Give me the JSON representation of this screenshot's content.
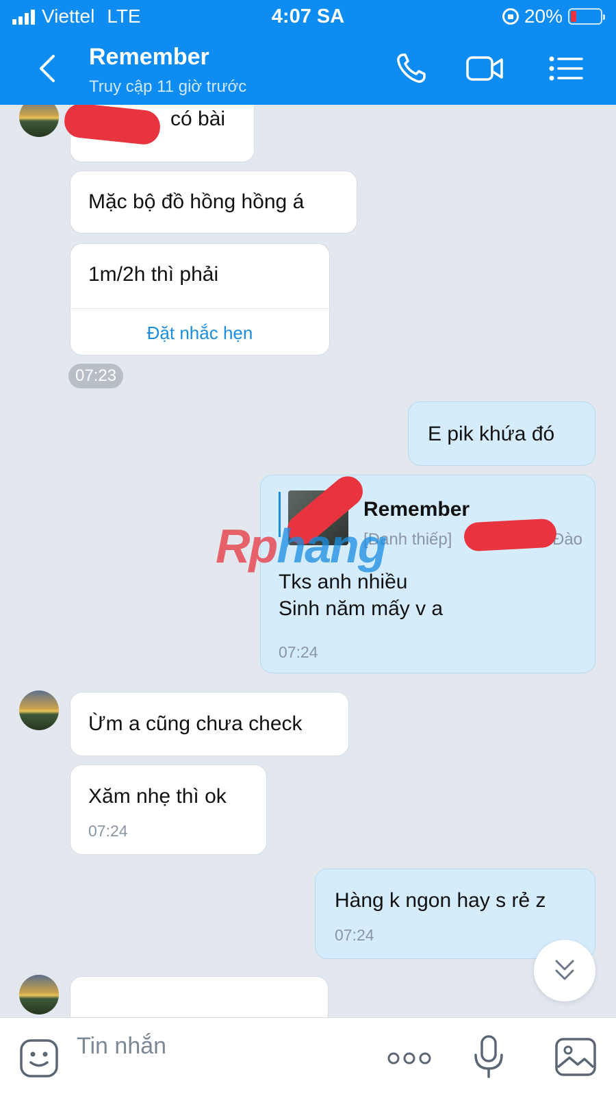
{
  "status_bar": {
    "carrier": "Viettel",
    "network": "LTE",
    "time": "4:07 SA",
    "battery": "20%",
    "battery_level": 0.2,
    "battery_color": "#e8343e"
  },
  "header": {
    "title": "Remember",
    "subtitle": "Truy cập 11 giờ trước",
    "color": "#0e8cf2"
  },
  "messages": [
    {
      "dir": "in",
      "text": "có bài",
      "redacted": true
    },
    {
      "dir": "in",
      "text": "Mặc bộ đồ hồng hồng á"
    },
    {
      "dir": "in",
      "text": "1m/2h thì phải",
      "action": "Đặt nhắc hẹn"
    },
    {
      "dir": "in",
      "time_chip": "07:23"
    },
    {
      "dir": "out",
      "text": "E pik khứa đó"
    },
    {
      "dir": "out",
      "card": {
        "name": "Remember",
        "label": "[Danh thiếp]",
        "tail": "Đào"
      },
      "lines": [
        "Tks anh nhiều",
        "Sinh năm mấy v a"
      ],
      "time": "07:24"
    },
    {
      "dir": "in",
      "text": "Ừm a cũng chưa check"
    },
    {
      "dir": "in",
      "text": "Xăm nhẹ thì ok",
      "time": "07:24"
    },
    {
      "dir": "out",
      "text": "Hàng k ngon hay s rẻ z",
      "time": "07:24"
    },
    {
      "dir": "in",
      "text": "",
      "partial": true
    }
  ],
  "watermark": {
    "text1": "Rp",
    "text2": "hang"
  },
  "composer": {
    "placeholder": "Tin nhắn"
  },
  "icons": {
    "back": "chevron-left-icon",
    "call": "phone-icon",
    "video": "video-camera-icon",
    "menu": "menu-list-icon",
    "sticker": "sticker-face-icon",
    "more": "more-dots-icon",
    "mic": "microphone-icon",
    "image": "image-icon",
    "scroll": "double-chevron-down-icon"
  },
  "colors": {
    "accent": "#0e8cf2",
    "link": "#1a8de0",
    "incoming": "#ffffff",
    "outgoing": "#d5ecfc",
    "background": "#e3e8ef"
  }
}
